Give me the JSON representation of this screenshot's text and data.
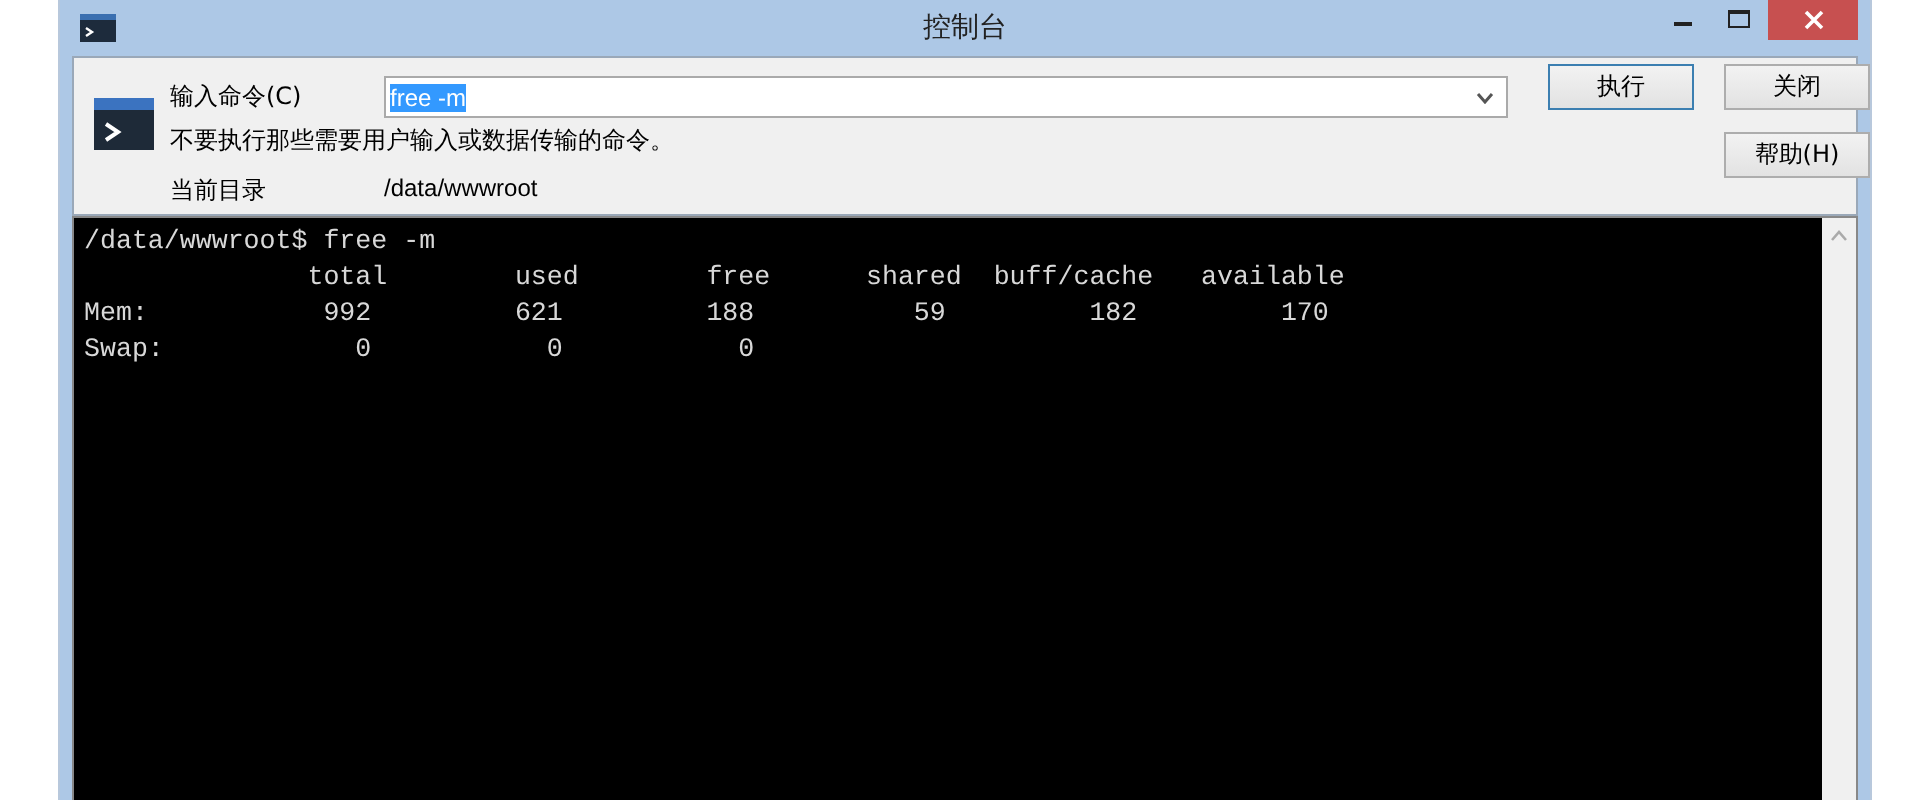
{
  "window": {
    "title": "控制台"
  },
  "command": {
    "label": "输入命令(C)",
    "value": "free -m",
    "value_selected": true,
    "warning": "不要执行那些需要用户输入或数据传输的命令。",
    "dir_label": "当前目录",
    "dir_value": "/data/wwwroot"
  },
  "buttons": [
    {
      "label": "执行",
      "default": true
    },
    {
      "label": "关闭",
      "default": false
    },
    {
      "label": "帮助(H)",
      "default": false
    }
  ],
  "terminal": {
    "lines": [
      "/data/wwwroot$ free -m",
      "              total        used        free      shared  buff/cache   available",
      "Mem:           992         621         188          59         182         170",
      "Swap:            0           0           0"
    ]
  }
}
